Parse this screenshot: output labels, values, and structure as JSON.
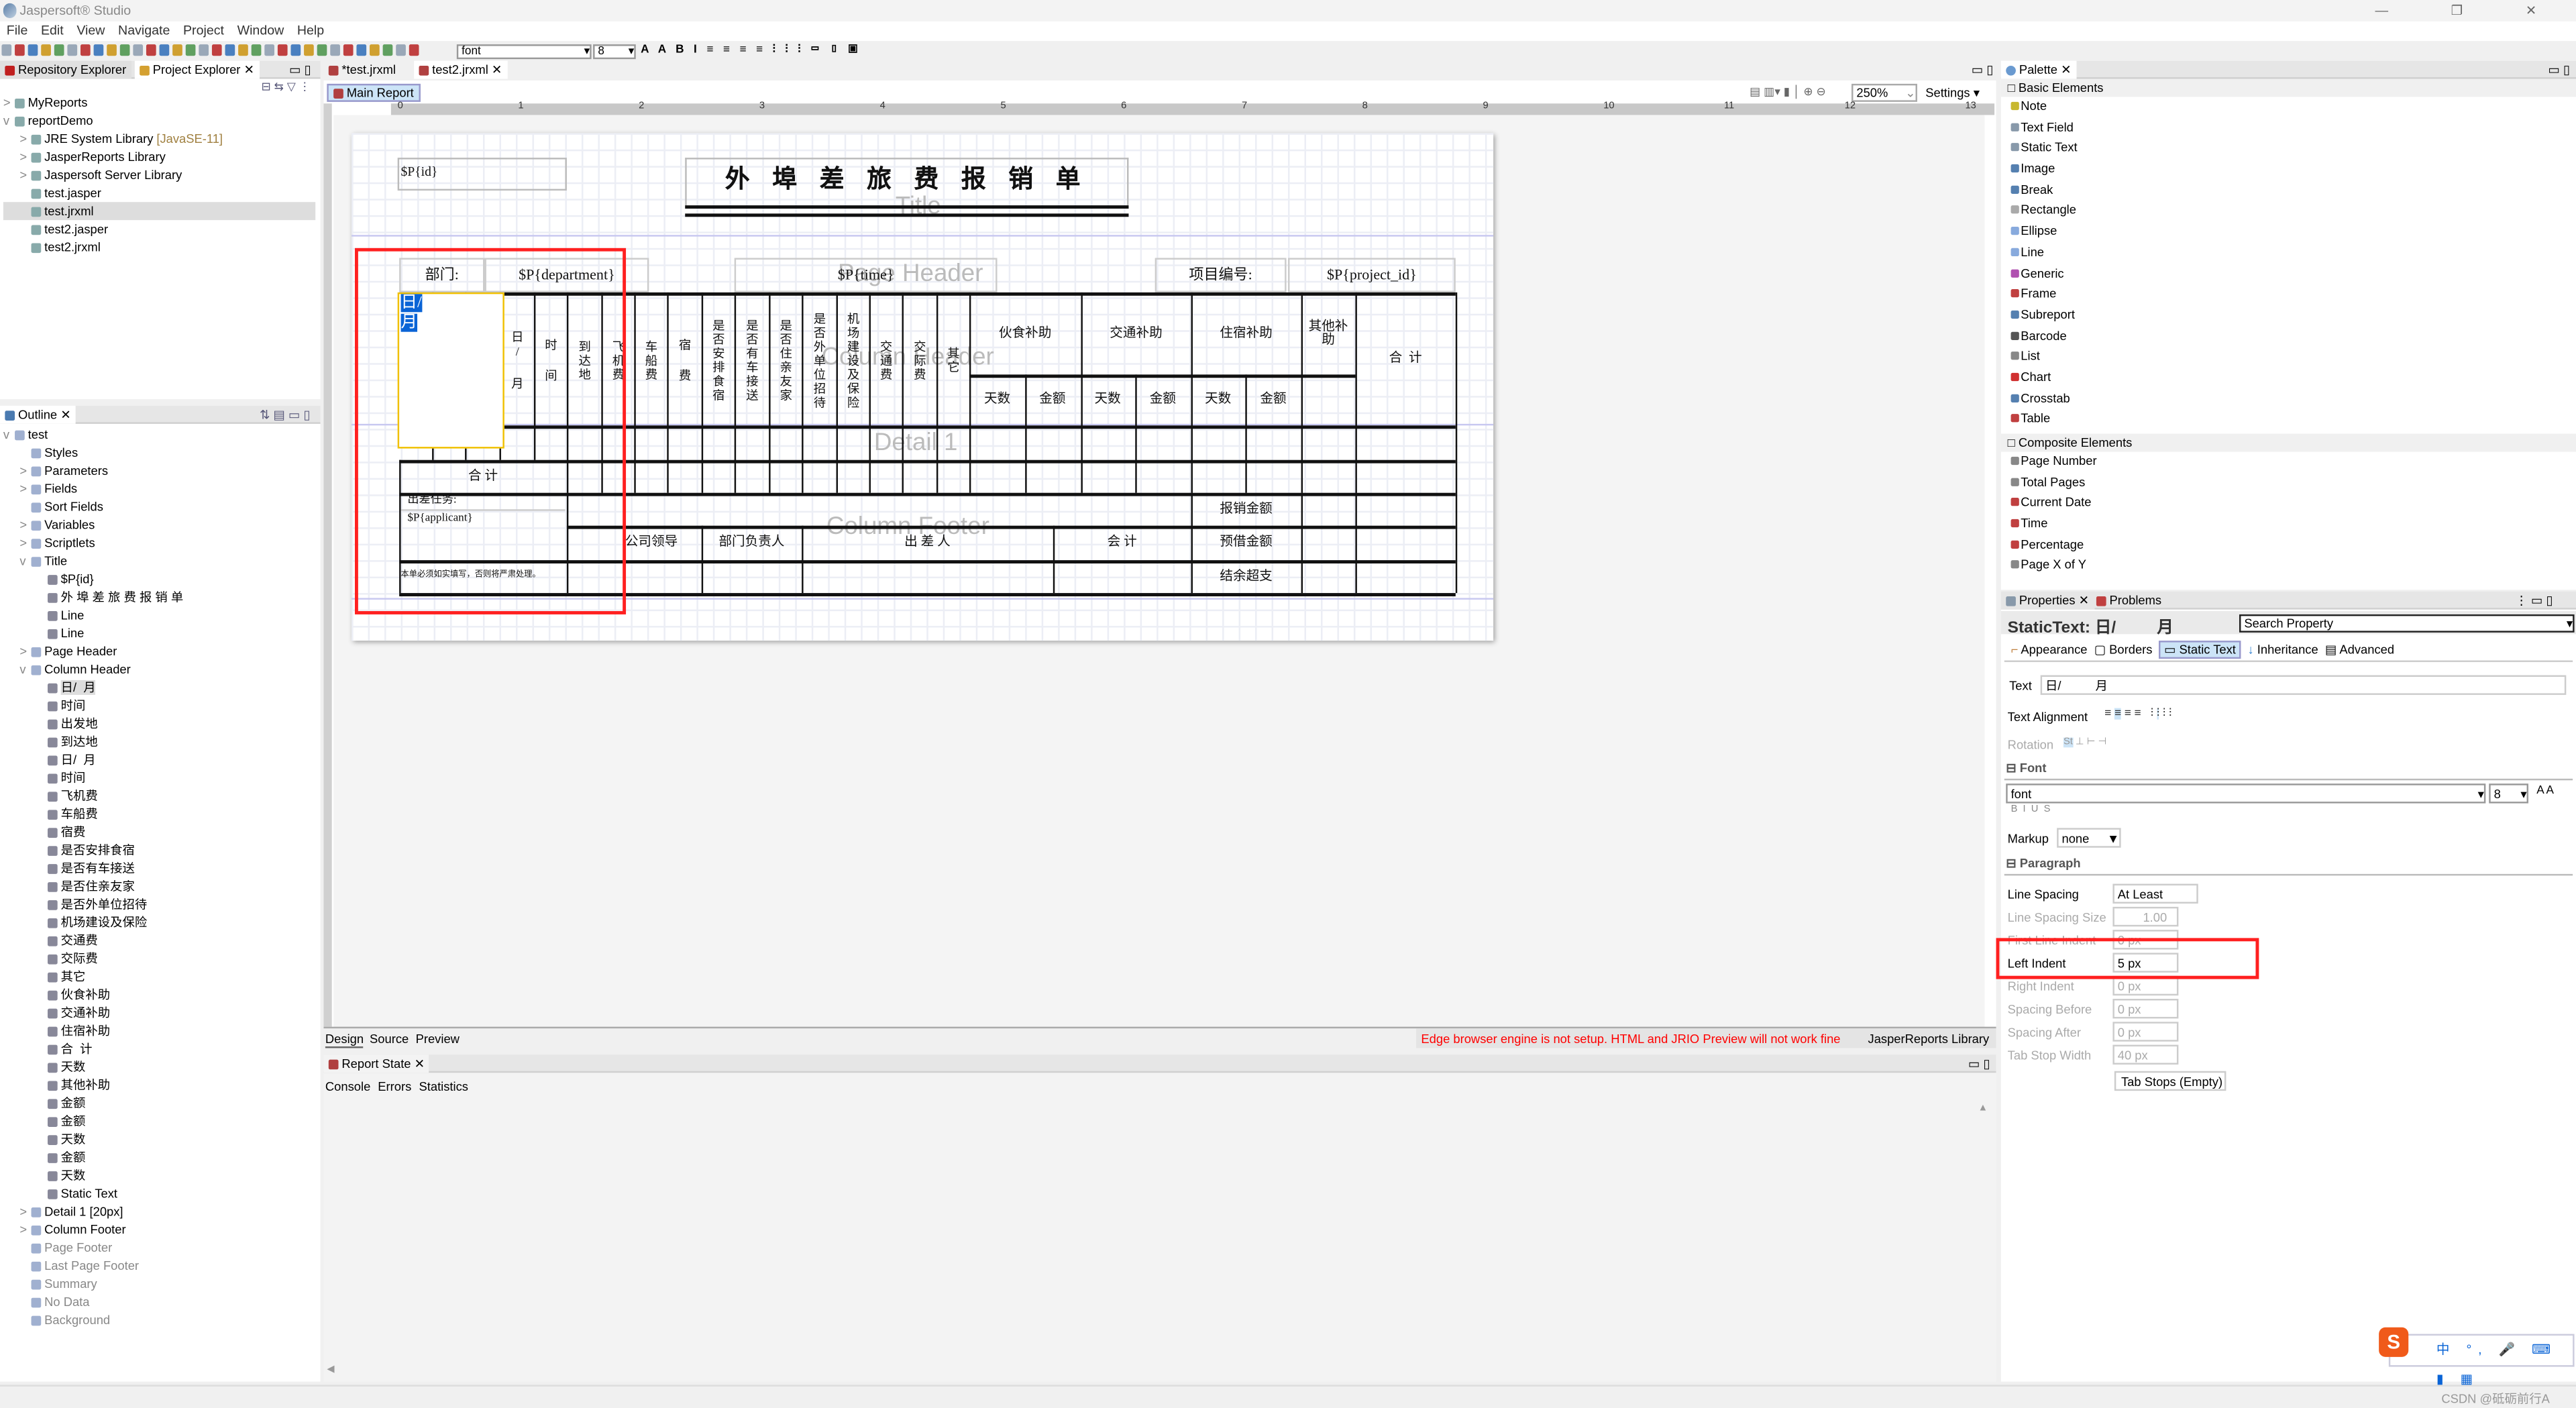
{
  "app": {
    "title": "Jaspersoft® Studio",
    "menu": [
      "File",
      "Edit",
      "View",
      "Navigate",
      "Project",
      "Window",
      "Help"
    ]
  },
  "toolbar": {
    "font": "font",
    "size": "8"
  },
  "left_top": {
    "tabs": [
      "Repository Explorer",
      "Project Explorer"
    ],
    "tree": [
      {
        "label": "MyReports",
        "lvl": 0,
        "exp": ">"
      },
      {
        "label": "reportDemo",
        "lvl": 0,
        "exp": "v"
      },
      {
        "label": "JRE System Library",
        "suffix": "[JavaSE-11]",
        "lvl": 1,
        "exp": ">"
      },
      {
        "label": "JasperReports Library",
        "lvl": 1,
        "exp": ">"
      },
      {
        "label": "Jaspersoft Server Library",
        "lvl": 1,
        "exp": ">"
      },
      {
        "label": "test.jasper",
        "lvl": 1
      },
      {
        "label": "test.jrxml",
        "lvl": 1,
        "sel": true
      },
      {
        "label": "test2.jasper",
        "lvl": 1
      },
      {
        "label": "test2.jrxml",
        "lvl": 1
      }
    ]
  },
  "outline": {
    "tab": "Outline",
    "items": [
      {
        "l": "test",
        "d": 0,
        "e": "v"
      },
      {
        "l": "Styles",
        "d": 1
      },
      {
        "l": "Parameters",
        "d": 1,
        "e": ">"
      },
      {
        "l": "Fields",
        "d": 1,
        "e": ">"
      },
      {
        "l": "Sort Fields",
        "d": 1
      },
      {
        "l": "Variables",
        "d": 1,
        "e": ">"
      },
      {
        "l": "Scriptlets",
        "d": 1,
        "e": ">"
      },
      {
        "l": "Title",
        "d": 1,
        "e": "v"
      },
      {
        "l": "$P{id}",
        "d": 2
      },
      {
        "l": "外 埠 差 旅 费 报 销 单",
        "d": 2
      },
      {
        "l": "Line",
        "d": 2
      },
      {
        "l": "Line",
        "d": 2
      },
      {
        "l": "Page Header",
        "d": 1,
        "e": ">"
      },
      {
        "l": "Column Header",
        "d": 1,
        "e": "v"
      },
      {
        "l": "日/  月",
        "d": 2,
        "sel": true
      },
      {
        "l": "时间",
        "d": 2
      },
      {
        "l": "出发地",
        "d": 2
      },
      {
        "l": "到达地",
        "d": 2
      },
      {
        "l": "日/  月",
        "d": 2
      },
      {
        "l": "时间",
        "d": 2
      },
      {
        "l": "飞机费",
        "d": 2
      },
      {
        "l": "车船费",
        "d": 2
      },
      {
        "l": "宿费",
        "d": 2
      },
      {
        "l": "是否安排食宿",
        "d": 2
      },
      {
        "l": "是否有车接送",
        "d": 2
      },
      {
        "l": "是否住亲友家",
        "d": 2
      },
      {
        "l": "是否外单位招待",
        "d": 2
      },
      {
        "l": "机场建设及保险",
        "d": 2
      },
      {
        "l": "交通费",
        "d": 2
      },
      {
        "l": "交际费",
        "d": 2
      },
      {
        "l": "其它",
        "d": 2
      },
      {
        "l": "伙食补助",
        "d": 2
      },
      {
        "l": "交通补助",
        "d": 2
      },
      {
        "l": "住宿补助",
        "d": 2
      },
      {
        "l": "合  计",
        "d": 2
      },
      {
        "l": "天数",
        "d": 2
      },
      {
        "l": "其他补助",
        "d": 2
      },
      {
        "l": "金额",
        "d": 2
      },
      {
        "l": "金额",
        "d": 2
      },
      {
        "l": "天数",
        "d": 2
      },
      {
        "l": "金额",
        "d": 2
      },
      {
        "l": "天数",
        "d": 2
      },
      {
        "l": "Static Text",
        "d": 2
      },
      {
        "l": "Detail 1 [20px]",
        "d": 1,
        "e": ">"
      },
      {
        "l": "Column Footer",
        "d": 1,
        "e": ">"
      },
      {
        "l": "Page Footer",
        "d": 1,
        "g": true
      },
      {
        "l": "Last Page Footer",
        "d": 1,
        "g": true
      },
      {
        "l": "Summary",
        "d": 1,
        "g": true
      },
      {
        "l": "No Data",
        "d": 1,
        "g": true
      },
      {
        "l": "Background",
        "d": 1,
        "g": true
      }
    ]
  },
  "editor": {
    "tabs": [
      "*test.jrxml",
      "test2.jrxml"
    ],
    "subtab": "Main Report",
    "zoom": "250%",
    "settings": "Settings",
    "ruler": [
      "0",
      "1",
      "2",
      "3",
      "4",
      "5",
      "6",
      "7",
      "8",
      "9",
      "10",
      "11",
      "12",
      "13"
    ],
    "bottom_tabs": [
      "Design",
      "Source",
      "Preview"
    ],
    "warning": "Edge browser engine is not setup. HTML and JRIO Preview will not work fine",
    "library": "JasperReports Library"
  },
  "report": {
    "id": "$P{id}",
    "title": "外 埠 差 旅 费 报 销 单",
    "bands": [
      "Title",
      "Page Header",
      "Column Header",
      "Detail 1",
      "Column Footer"
    ],
    "page_header": {
      "dept_label": "部门:",
      "dept": "$P{department}",
      "time": "$P{time}",
      "proj_label": "项目编号:",
      "proj": "$P{project_id}"
    },
    "selected": "日/ 月",
    "cols": [
      "日/ 月",
      "时 间",
      "到达地",
      "飞机费",
      "车船费",
      "宿 费",
      "是否安排食宿",
      "是否有车接送",
      "是否住亲友家",
      "是否外单位招待",
      "机场建设及保险",
      "交通费",
      "交际费",
      "其它"
    ],
    "groups": [
      "伙食补助",
      "交通补助",
      "住宿补助",
      "其他补助",
      "合  计"
    ],
    "sub": [
      "天数",
      "金额",
      "天数",
      "金额",
      "天数",
      "金额"
    ],
    "total": "合        计",
    "footer": {
      "task": "出差任务:",
      "applicant": "$P{applicant}",
      "reimb": "报销金额",
      "leader": "公司领导",
      "dept_head": "部门负责人",
      "traveler": "出 差 人",
      "accountant": "会        计",
      "advance": "预借金额",
      "balance": "结余超支",
      "note": "本单必须如实填写，否则将严肃处理。"
    }
  },
  "report_state": {
    "tab": "Report State",
    "tabs": [
      "Console",
      "Errors",
      "Statistics"
    ]
  },
  "palette": {
    "tab": "Palette",
    "basic": "Basic Elements",
    "basic_items": [
      {
        "l": "Note",
        "c": "#c8b830"
      },
      {
        "l": "Text Field",
        "c": "#8899aa"
      },
      {
        "l": "Static Text",
        "c": "#8899aa"
      },
      {
        "l": "Image",
        "c": "#5580b0"
      },
      {
        "l": "Break",
        "c": "#5580b0"
      },
      {
        "l": "Rectangle",
        "c": "#aaaaaa"
      },
      {
        "l": "Ellipse",
        "c": "#88aadd"
      },
      {
        "l": "Line",
        "c": "#88aadd"
      },
      {
        "l": "Generic",
        "c": "#b050b0"
      },
      {
        "l": "Frame",
        "c": "#c04040"
      },
      {
        "l": "Subreport",
        "c": "#5580b0"
      },
      {
        "l": "Barcode",
        "c": "#555555"
      },
      {
        "l": "List",
        "c": "#888888"
      },
      {
        "l": "Chart",
        "c": "#d03030"
      },
      {
        "l": "Crosstab",
        "c": "#5580b0"
      },
      {
        "l": "Table",
        "c": "#c04040"
      }
    ],
    "composite": "Composite Elements",
    "composite_items": [
      {
        "l": "Page Number",
        "c": "#888888"
      },
      {
        "l": "Total Pages",
        "c": "#888888"
      },
      {
        "l": "Current Date",
        "c": "#c04040"
      },
      {
        "l": "Time",
        "c": "#c04040"
      },
      {
        "l": "Percentage",
        "c": "#c04040"
      },
      {
        "l": "Page X of Y",
        "c": "#888888"
      }
    ]
  },
  "properties": {
    "tabs": [
      "Properties",
      "Problems"
    ],
    "header": "StaticText: 日/         月",
    "search": "Search Property",
    "subtabs": [
      "Appearance",
      "Borders",
      "Static Text",
      "Inheritance",
      "Advanced"
    ],
    "text_label": "Text",
    "text_value": "日/          月",
    "align_label": "Text Alignment",
    "rotation_label": "Rotation",
    "font_section": "Font",
    "font": "font",
    "font_size": "8",
    "markup_label": "Markup",
    "markup": "none",
    "para_section": "Paragraph",
    "rows": [
      {
        "l": "Line Spacing",
        "v": "At Least"
      },
      {
        "l": "Line Spacing Size",
        "v": "1.00"
      },
      {
        "l": "First Line Indent",
        "v": "0 px"
      },
      {
        "l": "Left Indent",
        "v": "5 px"
      },
      {
        "l": "Right Indent",
        "v": "0 px"
      },
      {
        "l": "Spacing Before",
        "v": "0 px"
      },
      {
        "l": "Spacing After",
        "v": "0 px"
      },
      {
        "l": "Tab Stop Width",
        "v": "40 px"
      }
    ],
    "tab_stops": "Tab Stops (Empty)"
  },
  "ime": {
    "items": [
      "中",
      "°,"
    ]
  },
  "watermark": "CSDN @砥砺前行A",
  "colors": {
    "highlight": "#ff2020",
    "selection": "#0a64d6",
    "warning": "#ff0000"
  }
}
